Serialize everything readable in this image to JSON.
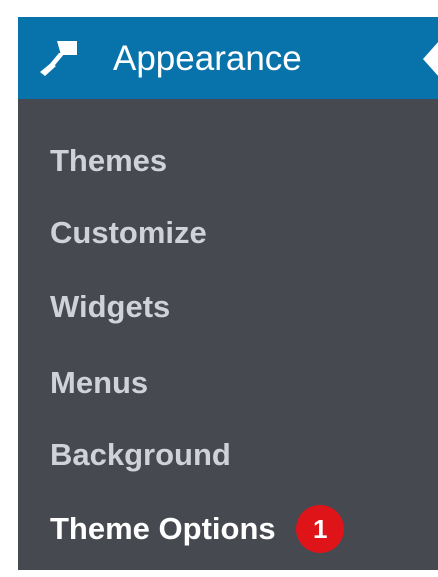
{
  "header": {
    "title": "Appearance",
    "icon": "paintbrush-icon",
    "arrow_icon": "current-menu-arrow-icon",
    "background_color": "#0873aa"
  },
  "submenu": {
    "items": [
      {
        "label": "Themes",
        "current": false
      },
      {
        "label": "Customize",
        "current": false
      },
      {
        "label": "Widgets",
        "current": false
      },
      {
        "label": "Menus",
        "current": false
      },
      {
        "label": "Background",
        "current": false
      },
      {
        "label": "Theme Options",
        "current": true,
        "badge": "1"
      }
    ]
  },
  "colors": {
    "menu_background": "#464a50",
    "item_text": "#cfd3d8",
    "current_item_text": "#ffffff",
    "badge": "#de1419"
  }
}
